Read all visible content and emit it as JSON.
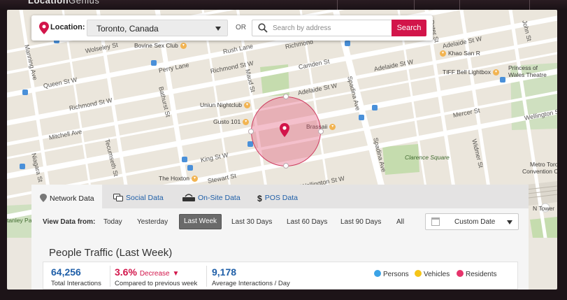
{
  "app": {
    "logo_bold": "Location",
    "logo_light": "Genius"
  },
  "location_bar": {
    "label": "Location:",
    "selected_location": "Toronto, Canada",
    "or_text": "OR",
    "search_placeholder": "Search by address",
    "search_button": "Search"
  },
  "map": {
    "streets": {
      "queen": "Queen St W",
      "richmond_left": "Richmond St W",
      "richmond_mid": "Richmond St W",
      "richmond_right": "Richmond",
      "adelaide_mid": "Adelaide St W",
      "adelaide_right1": "Adelaide St W",
      "adelaide_right2": "Adelaide St W",
      "king": "King St W",
      "stewart": "Stewart St",
      "wellington_mid": "Wellington St W",
      "wellington_right": "Wellington S",
      "mitchell": "Mitchell Ave",
      "wolseley": "Wolseley St",
      "rush": "Rush Lane",
      "perry": "Perry Lane",
      "camden": "Camden St",
      "mercer": "Mercer St",
      "bathurst": "Bathurst St",
      "tecumseth": "Tecumseth St",
      "niagara": "Niagara St",
      "maud": "Maud St",
      "spadina": "Spadina Ave",
      "spadina2": "Spadina Ave",
      "peter": "Peter St",
      "john": "John St",
      "manning": "Manning Ave",
      "widmer": "Widmer St"
    },
    "pois": {
      "bovine": "Bovine Sex Club",
      "uniun": "Uniun Nightclub",
      "gusto": "Gusto 101",
      "hoxton": "The Hoxton",
      "brassaii": "Brassaii",
      "khao": "Khao San R",
      "tiff": "TIFF Bell Lightbox",
      "princess": "Princess of",
      "princess2": "Wales Theatre",
      "clarence": "Clarence Square",
      "metro": "Metro Toronto",
      "metro2": "Convention Cent",
      "cntower": "N Tower",
      "tanley": "tanley Par"
    }
  },
  "tabs": [
    {
      "label": "Network Data",
      "icon": "network-icon"
    },
    {
      "label": "Social Data",
      "icon": "social-icon"
    },
    {
      "label": "On-Site Data",
      "icon": "onsite-icon"
    },
    {
      "label": "POS Data",
      "icon": "dollar-icon"
    }
  ],
  "view_data": {
    "label": "View Data from:",
    "options": [
      "Today",
      "Yesterday",
      "Last Week",
      "Last 30 Days",
      "Last 60 Days",
      "Last 90 Days",
      "All"
    ],
    "selected": "Last Week",
    "custom_date": "Custom Date"
  },
  "traffic": {
    "title": "People Traffic (Last Week)",
    "total_value": "64,256",
    "total_label": "Total Interactions",
    "change_value": "3.6%",
    "change_direction": "Decrease",
    "change_label": "Compared to previous week",
    "avg_value": "9,178",
    "avg_label": "Average Interactions / Day",
    "legend": [
      {
        "label": "Persons",
        "color": "#3ba3e6"
      },
      {
        "label": "Vehicles",
        "color": "#f5c518"
      },
      {
        "label": "Residents",
        "color": "#e6336b"
      }
    ]
  },
  "colors": {
    "accent": "#d2154a",
    "link": "#1f5fa8"
  }
}
